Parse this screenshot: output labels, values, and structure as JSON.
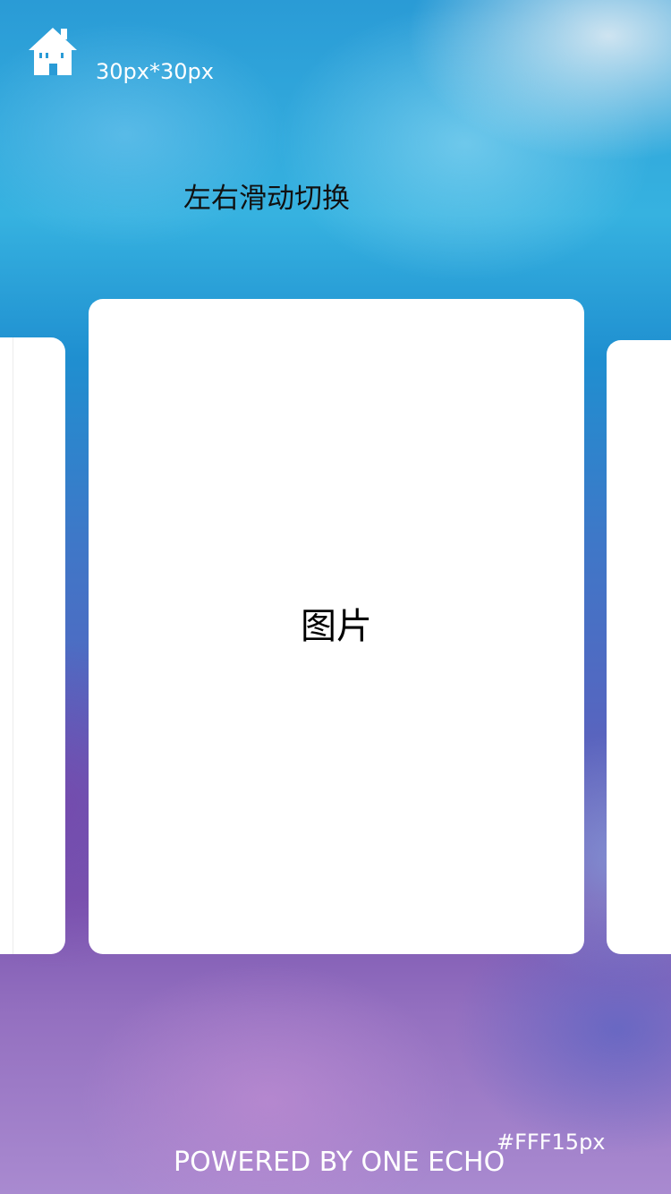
{
  "header": {
    "home_icon": "home-icon",
    "size_label": "30px*30px"
  },
  "hint": "左右滑动切换",
  "carousel": {
    "main_card_label": "图片"
  },
  "footer": {
    "powered_by": "POWERED BY ONE ECHO",
    "note": "#FFF15px"
  },
  "colors": {
    "icon": "#ffffff",
    "card": "#ffffff",
    "hint_text": "#111111",
    "footer_text": "#ffffff"
  }
}
